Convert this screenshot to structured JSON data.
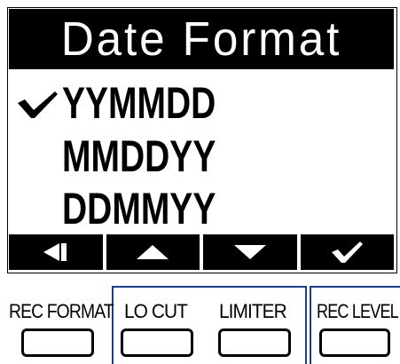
{
  "screen": {
    "title": "Date Format",
    "options": [
      "YYMMDD",
      "MMDDYY",
      "DDMMYY"
    ],
    "selected_index": 0
  },
  "nav_bar": {
    "buttons": [
      {
        "icon": "back-arrow-icon"
      },
      {
        "icon": "up-arrow-icon"
      },
      {
        "icon": "down-arrow-icon"
      },
      {
        "icon": "confirm-check-icon"
      }
    ]
  },
  "hardware_buttons": {
    "rec_format": "REC FORMAT",
    "lo_cut": "LO CUT",
    "limiter": "LIMITER",
    "rec_level": "REC LEVEL"
  },
  "colors": {
    "group_frame": "#1f3d8f",
    "lcd_background": "#ffffff",
    "lcd_foreground": "#000000"
  }
}
